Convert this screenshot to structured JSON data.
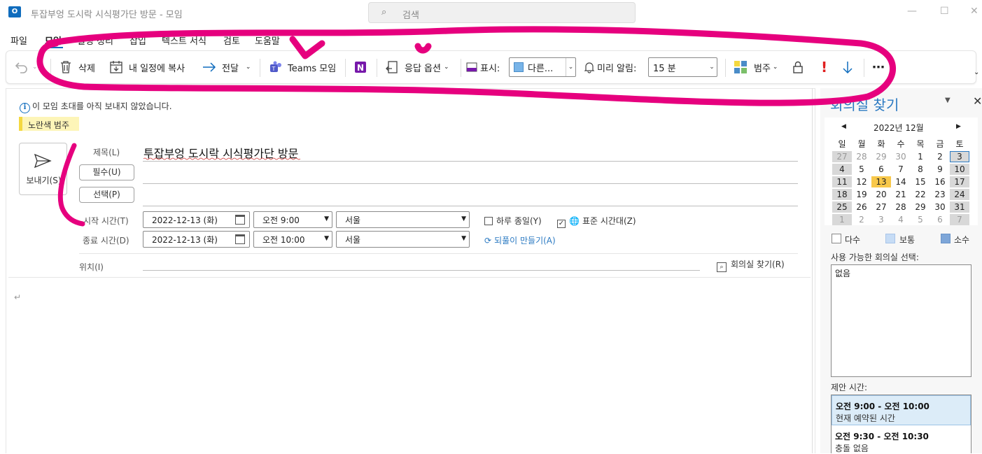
{
  "window": {
    "app_icon": "outlook-icon",
    "title": "투잡부엉 도시락 시식평가단 방문  -  모임",
    "search_placeholder": "검색"
  },
  "menu": [
    "파일",
    "모임",
    "일정 정리",
    "삽입",
    "텍스트 서식",
    "검토",
    "도움말"
  ],
  "ribbon": {
    "undo_icon": "undo-icon",
    "delete": "삭제",
    "copy_to_calendar": "내 일정에 복사",
    "forward": "전달",
    "teams_meeting": "Teams 모임",
    "onenote_icon": "onenote-icon",
    "response_options": "응답 옵션",
    "show_as_label": "표시:",
    "show_as_value": "다른...",
    "reminder_label": "미리 알림:",
    "reminder_value": "15 분",
    "categorize": "범주",
    "lock_icon": "lock-icon",
    "importance_high_icon": "exclamation-icon",
    "importance_low_icon": "down-arrow-icon",
    "more_icon": "more-icon"
  },
  "info": {
    "notice": "이 모임 초대를 아직 보내지 않았습니다.",
    "category": "노란색 범주"
  },
  "form": {
    "send": "보내기(S)",
    "subject_label": "제목(L)",
    "subject_value": "투잡부엉 도시락 시식평가단 방문",
    "required_btn": "필수(U)",
    "optional_btn": "선택(P)",
    "start_label": "시작 시간(T)",
    "end_label": "종료 시간(D)",
    "start_date": "2022-12-13 (화)",
    "start_time": "오전 9:00",
    "start_tz": "서울",
    "end_date": "2022-12-13 (화)",
    "end_time": "오전 10:00",
    "end_tz": "서울",
    "all_day": "하루 종일(Y)",
    "time_zones": "표준 시간대(Z)",
    "recurrence": "되풀이 만들기(A)",
    "location_label": "위치(I)",
    "room_finder_btn": "회의실 찾기(R)",
    "body_mark": "↵"
  },
  "room_finder": {
    "title": "회의실 찾기",
    "month": "2022년 12월",
    "weekdays": [
      "일",
      "월",
      "화",
      "수",
      "목",
      "금",
      "토"
    ],
    "weeks": [
      [
        "27",
        "28",
        "29",
        "30",
        "1",
        "2",
        "3"
      ],
      [
        "4",
        "5",
        "6",
        "7",
        "8",
        "9",
        "10"
      ],
      [
        "11",
        "12",
        "13",
        "14",
        "15",
        "16",
        "17"
      ],
      [
        "18",
        "19",
        "20",
        "21",
        "22",
        "23",
        "24"
      ],
      [
        "25",
        "26",
        "27",
        "28",
        "29",
        "30",
        "31"
      ],
      [
        "1",
        "2",
        "3",
        "4",
        "5",
        "6",
        "7"
      ]
    ],
    "selected_day": "13",
    "today": "3",
    "legend": [
      "다수",
      "보통",
      "소수"
    ],
    "legend_colors": [
      "#ffffff",
      "#c6dcf5",
      "#7ea6d8"
    ],
    "available_label": "사용 가능한 회의실 선택:",
    "room_value": "없음",
    "suggest_label": "제안 시간:",
    "suggestions": [
      {
        "time": "오전 9:00 - 오전 10:00",
        "note": "현재 예약된 시간"
      },
      {
        "time": "오전 9:30 - 오전 10:30",
        "note": "충돌 없음"
      }
    ]
  },
  "colors": {
    "accent": "#0f6cbd",
    "annotation": "#e6007e",
    "selected_day": "#f8c84a",
    "category_yellow": "#fdf5b8"
  }
}
